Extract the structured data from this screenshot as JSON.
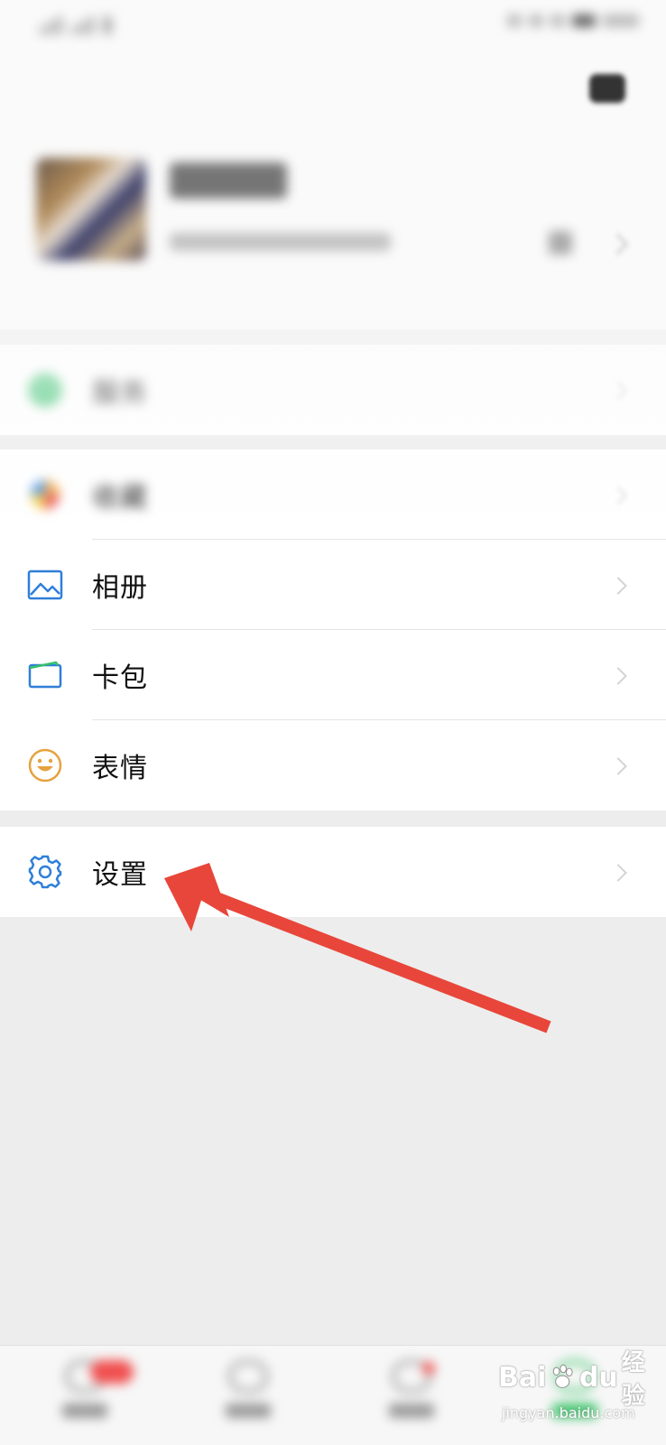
{
  "menu": {
    "items": [
      {
        "label": "服务",
        "icon": "wechat-pay-icon",
        "blurred": true
      },
      {
        "label": "收藏",
        "icon": "favorites-icon",
        "blurred": true
      },
      {
        "label": "相册",
        "icon": "photo-album-icon",
        "blurred": false
      },
      {
        "label": "卡包",
        "icon": "card-wallet-icon",
        "blurred": false
      },
      {
        "label": "表情",
        "icon": "sticker-smile-icon",
        "blurred": false
      },
      {
        "label": "设置",
        "icon": "gear-icon",
        "blurred": false
      }
    ]
  },
  "annotation": {
    "type": "red-arrow",
    "target": "设置",
    "color": "#e8463a"
  },
  "colors": {
    "icon_blue": "#2f7fd8",
    "icon_green": "#35c06b",
    "icon_orange": "#e6a23c",
    "background": "#ededed",
    "cell": "#ffffff"
  },
  "watermark": {
    "brand": "Bai",
    "brand2": "du",
    "suffix": "经验",
    "sub": "jingyan.baidu.com"
  }
}
